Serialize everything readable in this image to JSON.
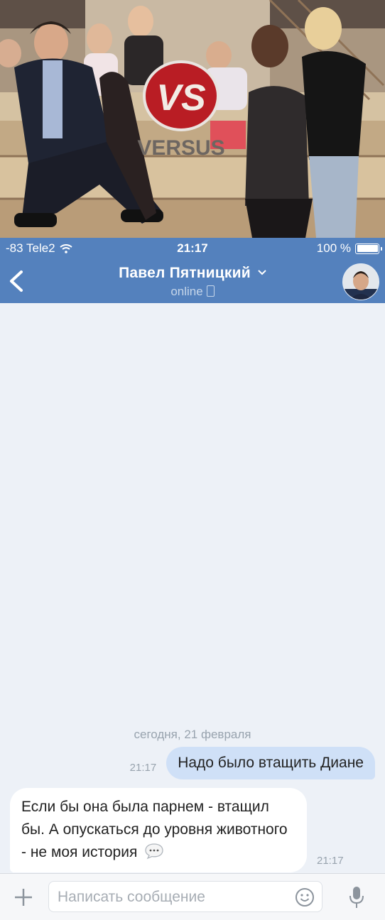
{
  "photo": {
    "logo_text": "VS",
    "logo_subtext": "VERSUS"
  },
  "status_bar": {
    "signal": "-83 Tele2",
    "time": "21:17",
    "battery": "100 %"
  },
  "header": {
    "back_icon": "chevron-left-icon",
    "contact_name": "Павел Пятницкий",
    "status": "online",
    "status_icon": "phone-icon",
    "dropdown_icon": "chevron-down-icon",
    "avatar_icon": "avatar"
  },
  "chat": {
    "date_separator": "сегодня, 21 февраля",
    "messages": [
      {
        "direction": "out",
        "text": "Надо было втащить Диане",
        "time": "21:17"
      },
      {
        "direction": "in",
        "text": "Если бы она была парнем - втащил бы. А опускаться до уровня животного - не моя история",
        "time": "21:17",
        "emoji_icon": "speech-bubble-icon"
      }
    ]
  },
  "composer": {
    "attach_icon": "plus-icon",
    "placeholder": "Написать сообщение",
    "value": "",
    "emoji_icon": "smile-icon",
    "voice_icon": "mic-icon"
  },
  "colors": {
    "header": "#5481bd",
    "chat_bg": "#edf1f7",
    "outgoing_bubble": "#cfe0f7",
    "incoming_bubble": "#ffffff"
  }
}
